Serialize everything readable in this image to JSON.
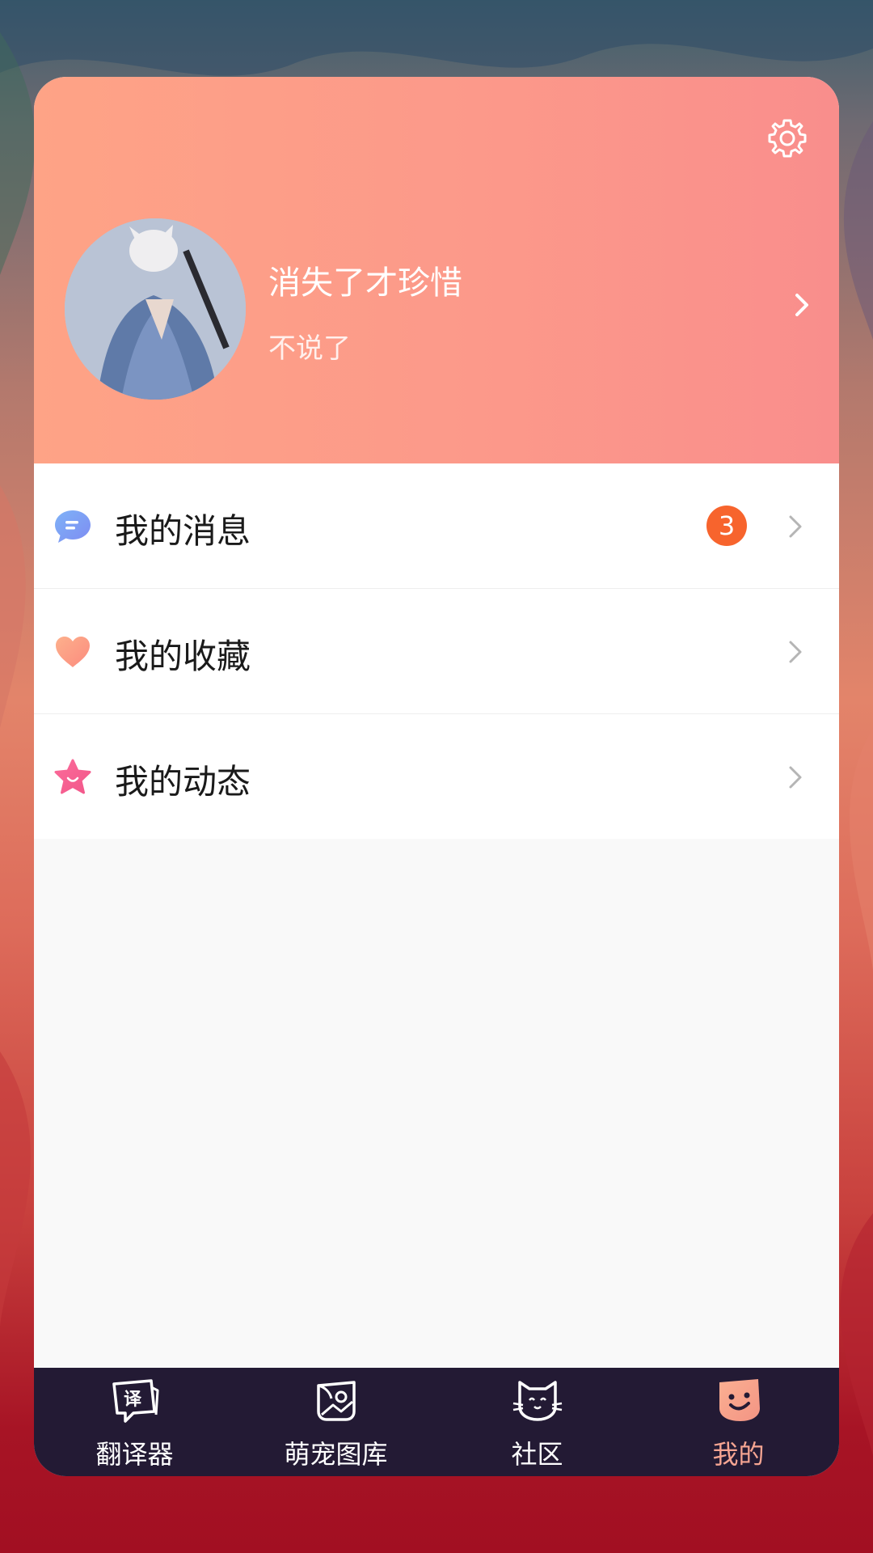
{
  "profile": {
    "name": "消失了才珍惜",
    "signature": "不说了"
  },
  "menu": {
    "items": [
      {
        "label": "我的消息",
        "icon": "message-bubble-icon",
        "badge": "3"
      },
      {
        "label": "我的收藏",
        "icon": "heart-icon"
      },
      {
        "label": "我的动态",
        "icon": "star-face-icon"
      }
    ]
  },
  "tabbar": {
    "items": [
      {
        "label": "翻译器",
        "icon": "translate-icon",
        "active": false
      },
      {
        "label": "萌宠图库",
        "icon": "pet-gallery-icon",
        "active": false
      },
      {
        "label": "社区",
        "icon": "cat-community-icon",
        "active": false
      },
      {
        "label": "我的",
        "icon": "smile-face-icon",
        "active": true
      }
    ]
  },
  "colors": {
    "header_gradient_start": "#fea386",
    "header_gradient_end": "#f98e8c",
    "badge": "#f7642d",
    "tabbar_bg": "#231a34",
    "tab_active": "#f6a592"
  }
}
